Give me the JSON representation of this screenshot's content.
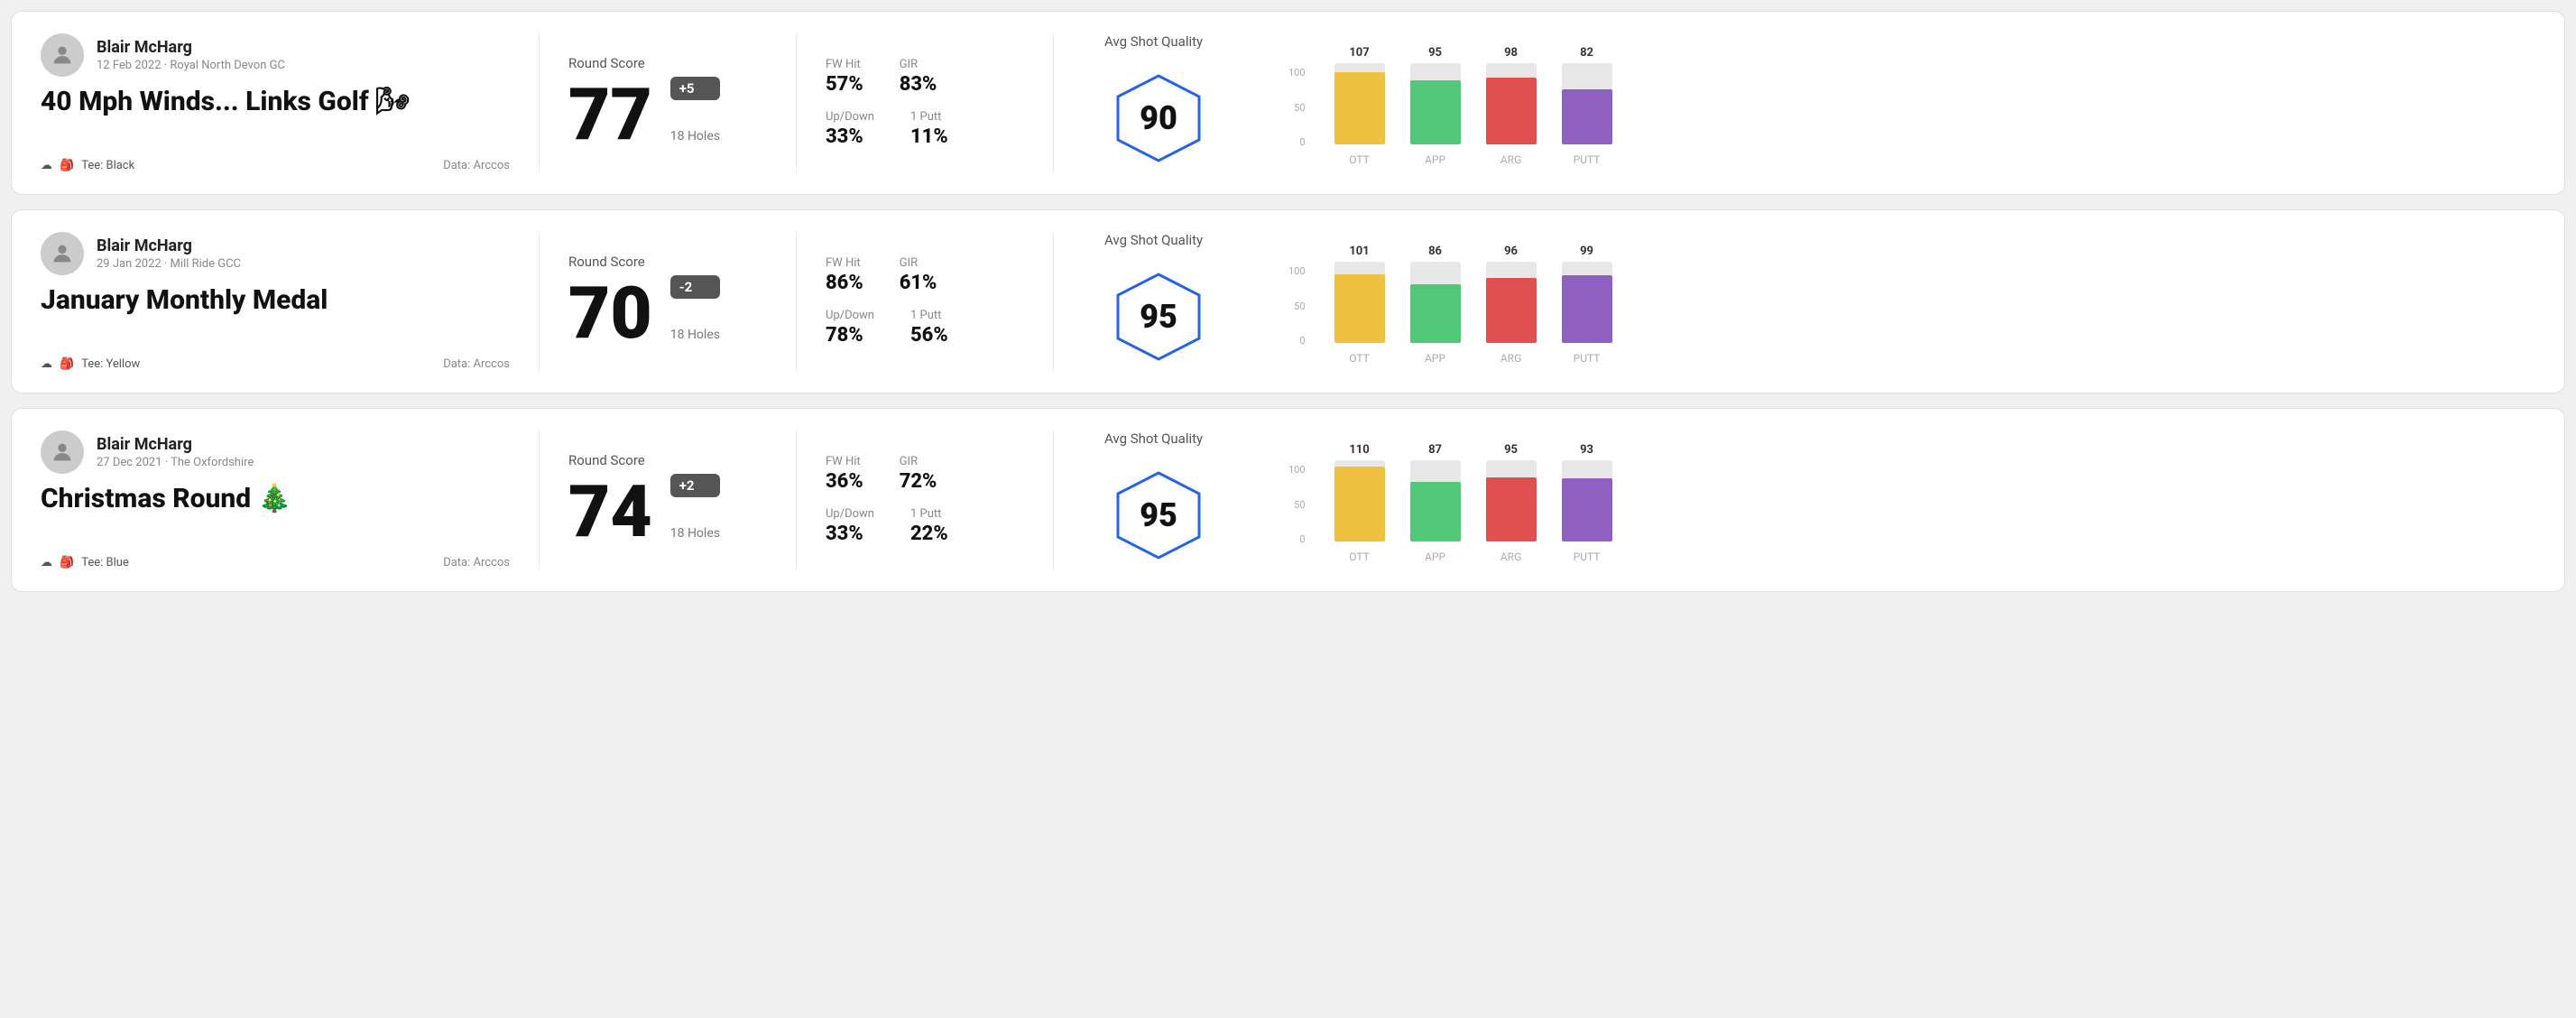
{
  "rounds": [
    {
      "id": "round1",
      "user": {
        "name": "Blair McHarg",
        "date_course": "12 Feb 2022 · Royal North Devon GC"
      },
      "title": "40 Mph Winds... Links Golf 🌬",
      "tee": "Black",
      "data_source": "Data: Arccos",
      "score": {
        "number": "77",
        "badge": "+5",
        "badge_type": "positive",
        "holes": "18 Holes"
      },
      "stats": {
        "fw_hit_label": "FW Hit",
        "fw_hit_value": "57%",
        "gir_label": "GIR",
        "gir_value": "83%",
        "updown_label": "Up/Down",
        "updown_value": "33%",
        "oneputt_label": "1 Putt",
        "oneputt_value": "11%"
      },
      "shot_quality": {
        "label": "Avg Shot Quality",
        "value": "90"
      },
      "chart": {
        "bars": [
          {
            "label": "OTT",
            "value": 107,
            "max": 120,
            "color_class": "color-ott",
            "height_pct": 89
          },
          {
            "label": "APP",
            "value": 95,
            "max": 120,
            "color_class": "color-app",
            "height_pct": 79
          },
          {
            "label": "ARG",
            "value": 98,
            "max": 120,
            "color_class": "color-arg",
            "height_pct": 82
          },
          {
            "label": "PUTT",
            "value": 82,
            "max": 120,
            "color_class": "color-putt",
            "height_pct": 68
          }
        ]
      }
    },
    {
      "id": "round2",
      "user": {
        "name": "Blair McHarg",
        "date_course": "29 Jan 2022 · Mill Ride GCC"
      },
      "title": "January Monthly Medal",
      "tee": "Yellow",
      "data_source": "Data: Arccos",
      "score": {
        "number": "70",
        "badge": "-2",
        "badge_type": "negative",
        "holes": "18 Holes"
      },
      "stats": {
        "fw_hit_label": "FW Hit",
        "fw_hit_value": "86%",
        "gir_label": "GIR",
        "gir_value": "61%",
        "updown_label": "Up/Down",
        "updown_value": "78%",
        "oneputt_label": "1 Putt",
        "oneputt_value": "56%"
      },
      "shot_quality": {
        "label": "Avg Shot Quality",
        "value": "95"
      },
      "chart": {
        "bars": [
          {
            "label": "OTT",
            "value": 101,
            "max": 120,
            "color_class": "color-ott",
            "height_pct": 84
          },
          {
            "label": "APP",
            "value": 86,
            "max": 120,
            "color_class": "color-app",
            "height_pct": 72
          },
          {
            "label": "ARG",
            "value": 96,
            "max": 120,
            "color_class": "color-arg",
            "height_pct": 80
          },
          {
            "label": "PUTT",
            "value": 99,
            "max": 120,
            "color_class": "color-putt",
            "height_pct": 83
          }
        ]
      }
    },
    {
      "id": "round3",
      "user": {
        "name": "Blair McHarg",
        "date_course": "27 Dec 2021 · The Oxfordshire"
      },
      "title": "Christmas Round 🎄",
      "tee": "Blue",
      "data_source": "Data: Arccos",
      "score": {
        "number": "74",
        "badge": "+2",
        "badge_type": "positive",
        "holes": "18 Holes"
      },
      "stats": {
        "fw_hit_label": "FW Hit",
        "fw_hit_value": "36%",
        "gir_label": "GIR",
        "gir_value": "72%",
        "updown_label": "Up/Down",
        "updown_value": "33%",
        "oneputt_label": "1 Putt",
        "oneputt_value": "22%"
      },
      "shot_quality": {
        "label": "Avg Shot Quality",
        "value": "95"
      },
      "chart": {
        "bars": [
          {
            "label": "OTT",
            "value": 110,
            "max": 120,
            "color_class": "color-ott",
            "height_pct": 92
          },
          {
            "label": "APP",
            "value": 87,
            "max": 120,
            "color_class": "color-app",
            "height_pct": 73
          },
          {
            "label": "ARG",
            "value": 95,
            "max": 120,
            "color_class": "color-arg",
            "height_pct": 79
          },
          {
            "label": "PUTT",
            "value": 93,
            "max": 120,
            "color_class": "color-putt",
            "height_pct": 78
          }
        ]
      }
    }
  ],
  "y_axis_labels": [
    "100",
    "50",
    "0"
  ]
}
